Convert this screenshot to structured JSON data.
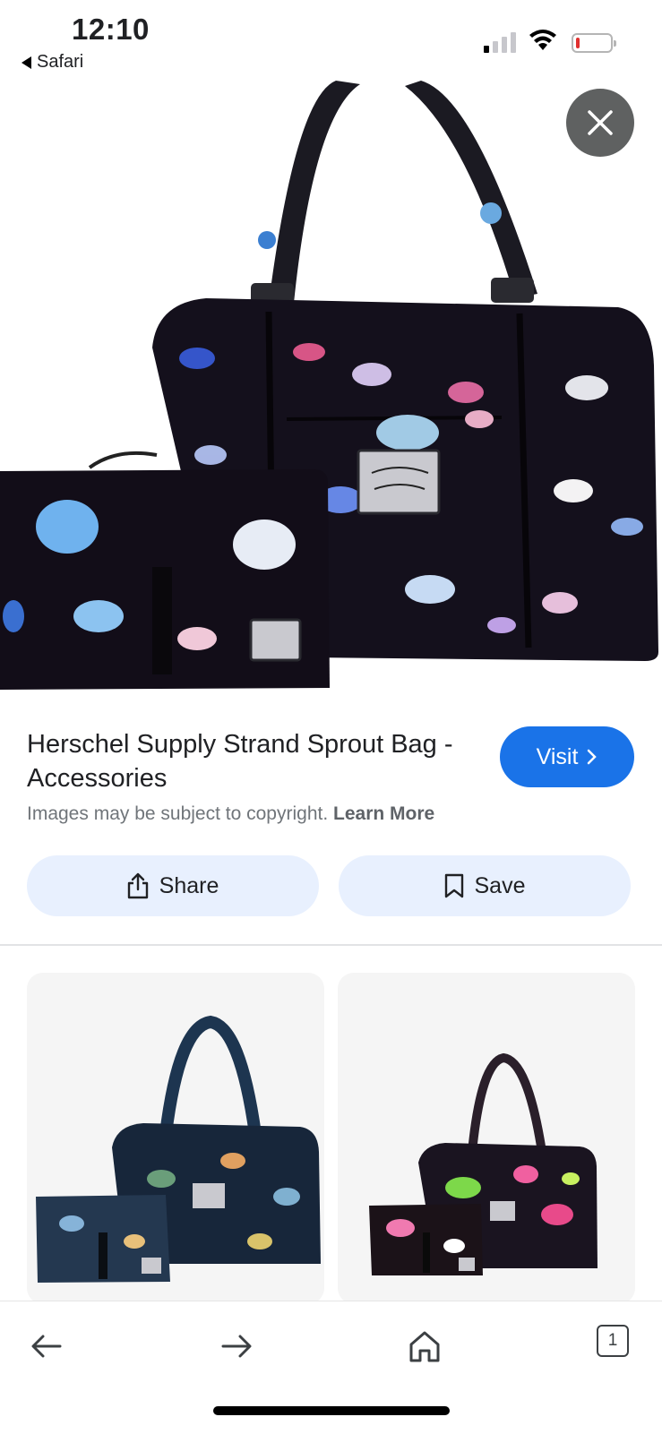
{
  "status_bar": {
    "time": "12:10",
    "back_app": "Safari"
  },
  "result": {
    "title": "Herschel Supply Strand Sprout Bag - Accessories",
    "visit_label": "Visit",
    "copyright_text": "Images may be subject to copyright.",
    "learn_more": "Learn More",
    "share_label": "Share",
    "save_label": "Save"
  },
  "toolbar": {
    "tab_count": "1"
  },
  "colors": {
    "accent": "#1a73e8",
    "action_bg": "#e8f0fe",
    "close_bg": "#5f6161"
  },
  "icons": [
    "close-icon",
    "chevron-right-icon",
    "share-icon",
    "bookmark-icon",
    "back-arrow-icon",
    "forward-arrow-icon",
    "home-icon",
    "tabs-icon"
  ]
}
